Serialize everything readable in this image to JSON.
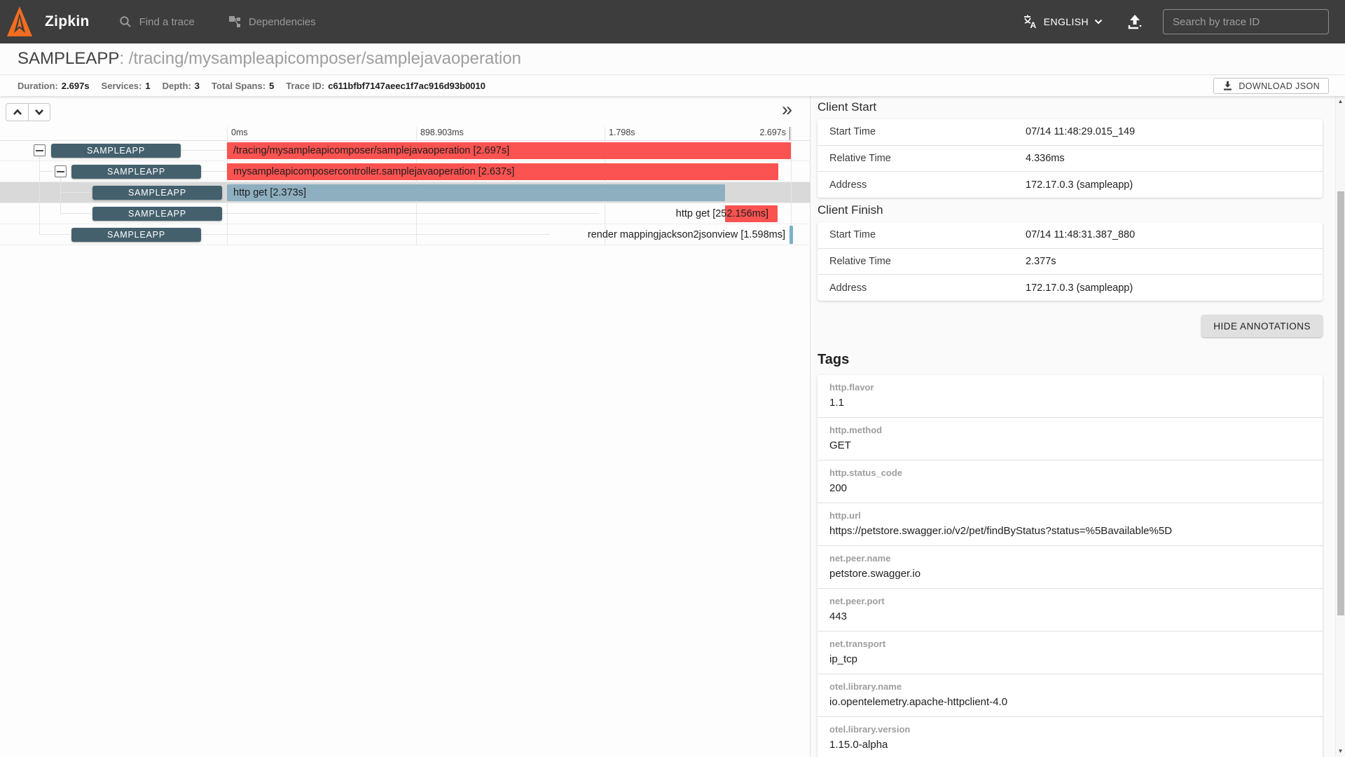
{
  "colors": {
    "navbar": "#3d3d3d",
    "span_red": "#fb5351",
    "span_blue": "#8eafc0",
    "service_badge": "#44606d",
    "row_highlight": "#d9d9d9"
  },
  "navbar": {
    "brand": "Zipkin",
    "find_a_trace": "Find a trace",
    "dependencies": "Dependencies",
    "language": "ENGLISH",
    "search_placeholder": "Search by trace ID"
  },
  "trace_header": {
    "service": "SAMPLEAPP",
    "operation": ": /tracing/mysampleapicomposer/samplejavaoperation"
  },
  "meta": {
    "items": [
      {
        "label": "Duration:",
        "value": "2.697s"
      },
      {
        "label": "Services:",
        "value": "1"
      },
      {
        "label": "Depth:",
        "value": "3"
      },
      {
        "label": "Total Spans:",
        "value": "5"
      },
      {
        "label": "Trace ID:",
        "value": "c611bfbf7147aeec1f7ac916d93b0010"
      }
    ],
    "download_label": "DOWNLOAD JSON"
  },
  "timeline": {
    "collapse_icon": "»",
    "ticks": [
      {
        "label": "0ms"
      },
      {
        "label": "898.903ms"
      },
      {
        "label": "1.798s"
      },
      {
        "label": "2.697s"
      }
    ],
    "rows": [
      {
        "service": "SAMPLEAPP",
        "depth": 0,
        "span_label": "/tracing/mysampleapicomposer/samplejavaoperation [2.697s]",
        "color": "red",
        "duration": "2.697s"
      },
      {
        "service": "SAMPLEAPP",
        "depth": 1,
        "span_label": "mysampleapicomposercontroller.samplejavaoperation [2.637s]",
        "color": "red",
        "duration": "2.637s"
      },
      {
        "service": "SAMPLEAPP",
        "depth": 2,
        "span_label": "http get [2.373s]",
        "color": "blue",
        "duration": "2.373s",
        "selected": true
      },
      {
        "service": "SAMPLEAPP",
        "depth": 2,
        "span_label": "http get [252.156ms]",
        "color": "red",
        "duration": "252.156ms"
      },
      {
        "service": "SAMPLEAPP",
        "depth": 1,
        "span_label": "render mappingjackson2jsonview [1.598ms]",
        "color": "blue",
        "duration": "1.598ms"
      }
    ]
  },
  "details": {
    "annotations": [
      {
        "title": "Client Start",
        "rows": [
          {
            "label": "Start Time",
            "value": "07/14 11:48:29.015_149"
          },
          {
            "label": "Relative Time",
            "value": "4.336ms"
          },
          {
            "label": "Address",
            "value": "172.17.0.3 (sampleapp)"
          }
        ]
      },
      {
        "title": "Client Finish",
        "rows": [
          {
            "label": "Start Time",
            "value": "07/14 11:48:31.387_880"
          },
          {
            "label": "Relative Time",
            "value": "2.377s"
          },
          {
            "label": "Address",
            "value": "172.17.0.3 (sampleapp)"
          }
        ]
      }
    ],
    "hide_annotations_label": "HIDE ANNOTATIONS",
    "tags_title": "Tags",
    "tags": [
      {
        "label": "http.flavor",
        "value": "1.1"
      },
      {
        "label": "http.method",
        "value": "GET"
      },
      {
        "label": "http.status_code",
        "value": "200"
      },
      {
        "label": "http.url",
        "value": "https://petstore.swagger.io/v2/pet/findByStatus?status=%5Bavailable%5D"
      },
      {
        "label": "net.peer.name",
        "value": "petstore.swagger.io"
      },
      {
        "label": "net.peer.port",
        "value": "443"
      },
      {
        "label": "net.transport",
        "value": "ip_tcp"
      },
      {
        "label": "otel.library.name",
        "value": "io.opentelemetry.apache-httpclient-4.0"
      },
      {
        "label": "otel.library.version",
        "value": "1.15.0-alpha"
      }
    ]
  },
  "scrollbar": {
    "up_icon": "▲",
    "down_icon": "▼"
  }
}
